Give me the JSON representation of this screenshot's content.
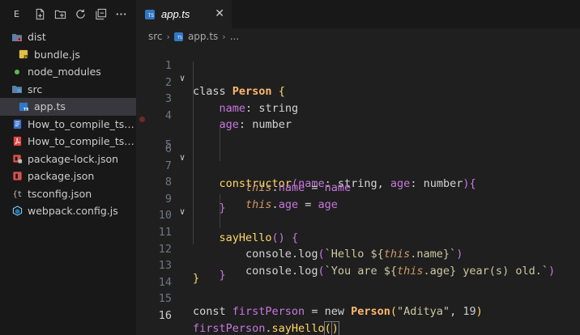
{
  "explorer": {
    "toolbar": {
      "section_letter": "E",
      "icons": [
        "new-file-icon",
        "new-folder-icon",
        "refresh-icon",
        "collapse-all-icon",
        "more-icon"
      ]
    },
    "items": [
      {
        "label": "dist",
        "icon": "folder-dist-icon",
        "level": 0
      },
      {
        "label": "bundle.js",
        "icon": "js-file-icon",
        "level": 1
      },
      {
        "label": "node_modules",
        "icon": "node-modules-icon",
        "level": 0
      },
      {
        "label": "src",
        "icon": "folder-src-icon",
        "level": 0
      },
      {
        "label": "app.ts",
        "icon": "ts-file-icon",
        "level": 1,
        "selected": true
      },
      {
        "label": "How_to_compile_ts_...",
        "icon": "doc-file-icon",
        "level": 0
      },
      {
        "label": "How_to_compile_ts_...",
        "icon": "pdf-file-icon",
        "level": 0
      },
      {
        "label": "package-lock.json",
        "icon": "npm-lock-icon",
        "level": 0
      },
      {
        "label": "package.json",
        "icon": "npm-icon",
        "level": 0
      },
      {
        "label": "tsconfig.json",
        "icon": "tsconfig-icon",
        "level": 0
      },
      {
        "label": "webpack.config.js",
        "icon": "webpack-icon",
        "level": 0
      }
    ]
  },
  "editor": {
    "tab": {
      "label": "app.ts",
      "badge": "TS",
      "close": "✕"
    },
    "breadcrumb": {
      "folder": "src",
      "file": "app.ts",
      "more": "..."
    },
    "active_line": 16,
    "lines": [
      {
        "n": "1",
        "fold": "∨"
      },
      {
        "n": "2"
      },
      {
        "n": "3"
      },
      {
        "n": "4"
      },
      {
        "n": "5",
        "fold": "∨",
        "breakpoint": true
      },
      {
        "n": "6"
      },
      {
        "n": "7"
      },
      {
        "n": "8"
      },
      {
        "n": "9",
        "fold": "∨"
      },
      {
        "n": "10"
      },
      {
        "n": "11"
      },
      {
        "n": "12"
      },
      {
        "n": "13"
      },
      {
        "n": "14"
      },
      {
        "n": "15"
      },
      {
        "n": "16"
      }
    ],
    "code": {
      "l1": {
        "kw": "class",
        "name": "Person",
        "brace": "{"
      },
      "l2": {
        "prop": "name",
        "colon": ":",
        "type": "string"
      },
      "l3": {
        "prop": "age",
        "colon": ":",
        "type": "number"
      },
      "l5": {
        "fn": "constructor",
        "open": "(",
        "p1": "name",
        "c1": ":",
        "t1": "string",
        "comma": ",",
        "p2": "age",
        "c2": ":",
        "t2": "number",
        "close": "){"
      },
      "l6": {
        "this": "this",
        "dot": ".",
        "prop": "name",
        "eq": " = ",
        "val": "name"
      },
      "l7": {
        "this": "this",
        "dot": ".",
        "prop": "age",
        "eq": " = ",
        "val": "age"
      },
      "l8": {
        "brace": "}"
      },
      "l9": {
        "fn": "sayHello",
        "paren": "()",
        "brace": " {"
      },
      "l10": {
        "obj": "console",
        "dot": ".",
        "fn": "log",
        "open": "(",
        "str1": "`Hello ${",
        "this": "this",
        "str2": ".name}`",
        "close": ")"
      },
      "l11": {
        "obj": "console",
        "dot": ".",
        "fn": "log",
        "open": "(",
        "str1": "`You are ${",
        "this": "this",
        "str2": ".age} year(s) old.`",
        "close": ")"
      },
      "l12": {
        "brace": "}"
      },
      "l13": {
        "brace": "}"
      },
      "l15": {
        "kw": "const",
        "var": "firstPerson",
        "eq": " = ",
        "new": "new",
        "cls": "Person",
        "open": "(",
        "arg1": "\"Aditya\"",
        "comma": ", ",
        "arg2": "19",
        "close": ")"
      },
      "l16": {
        "var": "firstPerson",
        "dot": ".",
        "fn": "sayHello",
        "open": "(",
        "close": ")"
      }
    }
  }
}
